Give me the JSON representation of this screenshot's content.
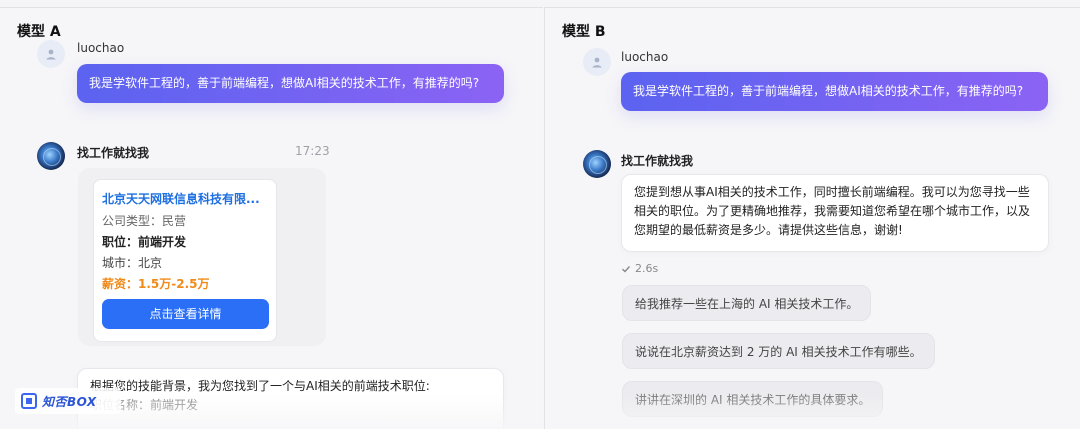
{
  "model_a": {
    "title": "模型 A",
    "user_name": "luochao",
    "user_message": "我是学软件工程的，善于前端编程，想做AI相关的技术工作，有推荐的吗?",
    "bot_name": "找工作就找我",
    "bot_time": "17:23",
    "job_card": {
      "company": "北京天天网联信息科技有限...",
      "company_type_label": "公司类型：",
      "company_type": "民营",
      "position_label": "职位：",
      "position": "前端开发",
      "city_label": "城市：",
      "city": "北京",
      "salary_label": "薪资：",
      "salary": "1.5万-2.5万",
      "button": "点击查看详情"
    },
    "bot_reply_line1": "根据您的技能背景，我为您找到了一个与AI相关的前端技术职位:",
    "bot_reply_line2": "职位名称：前端开发"
  },
  "model_b": {
    "title": "模型 B",
    "user_name": "luochao",
    "user_message": "我是学软件工程的，善于前端编程，想做AI相关的技术工作，有推荐的吗?",
    "bot_name": "找工作就找我",
    "bot_reply": "您提到想从事AI相关的技术工作，同时擅长前端编程。我可以为您寻找一些相关的职位。为了更精确地推荐，我需要知道您希望在哪个城市工作，以及您期望的最低薪资是多少。请提供这些信息，谢谢!",
    "elapsed": "2.6s",
    "suggestions": [
      "给我推荐一些在上海的 AI 相关技术工作。",
      "说说在北京薪资达到 2 万的 AI 相关技术工作有哪些。",
      "讲讲在深圳的 AI 相关技术工作的具体要求。"
    ]
  },
  "watermark": "知否BOX"
}
